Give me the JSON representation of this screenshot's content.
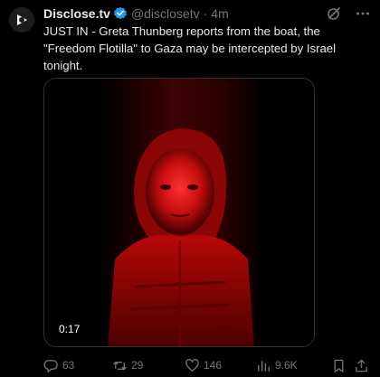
{
  "author": {
    "name": "Disclose.tv",
    "handle": "@disclosetv",
    "separator": "·",
    "time": "4m"
  },
  "tweet": {
    "text": "JUST IN - Greta Thunberg reports from the boat, the \"Freedom Flotilla\" to Gaza may be intercepted by Israel tonight."
  },
  "media": {
    "duration": "0:17"
  },
  "actions": {
    "replies": "63",
    "retweets": "29",
    "likes": "146",
    "views": "9.6K"
  },
  "icons": {
    "avatar": "disclose-logo",
    "verified": "verified-badge-icon",
    "grok": "grok-icon",
    "more": "more-icon",
    "reply": "reply-icon",
    "retweet": "retweet-icon",
    "like": "heart-icon",
    "views": "views-icon",
    "bookmark": "bookmark-icon",
    "share": "share-icon"
  },
  "colors": {
    "background": "#000000",
    "text": "#e7e9ea",
    "muted": "#71767b",
    "verified": "#1d9bf0",
    "video_tint": "#ff1a1a"
  }
}
